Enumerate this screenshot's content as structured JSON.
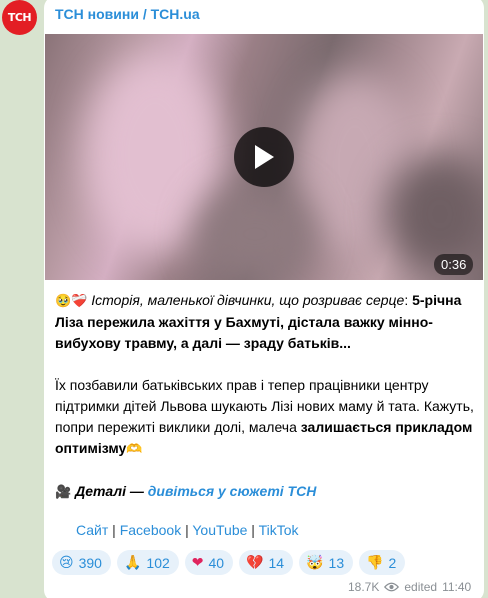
{
  "channel": {
    "avatar_text": "ТСН",
    "name": "ТСН новини / TCH.ua"
  },
  "video": {
    "duration": "0:36"
  },
  "post": {
    "p1_emoji": "🥹❤️‍🩹",
    "p1_italic": "Історія, маленької дівчинки, що розриває серце",
    "p1_colon": ":",
    "p1_bold": "5-річна Ліза пережила жахіття у Бахмуті, дістала важку мінно-вибухову травму, а далі — зраду батьків...",
    "p2_text": "Їх позбавили батьківських прав і тепер працівники центру підтримки дітей Львова шукають Лізі нових маму й тата. Кажуть, попри пережиті виклики долі, малеча ",
    "p2_bold": "залишається прикладом оптимізму",
    "p2_emoji": "🫶",
    "p3_emoji": "🎥",
    "p3_italic": "Деталі —",
    "p3_link": "дивіться у сюжеті ТСН"
  },
  "footer_links": {
    "site": "Сайт",
    "sep1": " | ",
    "facebook": "Facebook",
    "sep2": " | ",
    "youtube": "YouTube",
    "sep3": " | ",
    "tiktok": "TikTok"
  },
  "reactions": [
    {
      "emoji": "😢",
      "count": "390"
    },
    {
      "emoji": "🙏",
      "count": "102"
    },
    {
      "emoji": "❤",
      "count": "40"
    },
    {
      "emoji": "💔",
      "count": "14"
    },
    {
      "emoji": "🤯",
      "count": "13"
    },
    {
      "emoji": "👎",
      "count": "2"
    }
  ],
  "meta": {
    "views": "18.7K",
    "edited": "edited",
    "time": "11:40"
  },
  "colors": {
    "accent": "#2b8ed8",
    "brand_red": "#e31e24",
    "chat_bg": "#d8e3cf"
  }
}
